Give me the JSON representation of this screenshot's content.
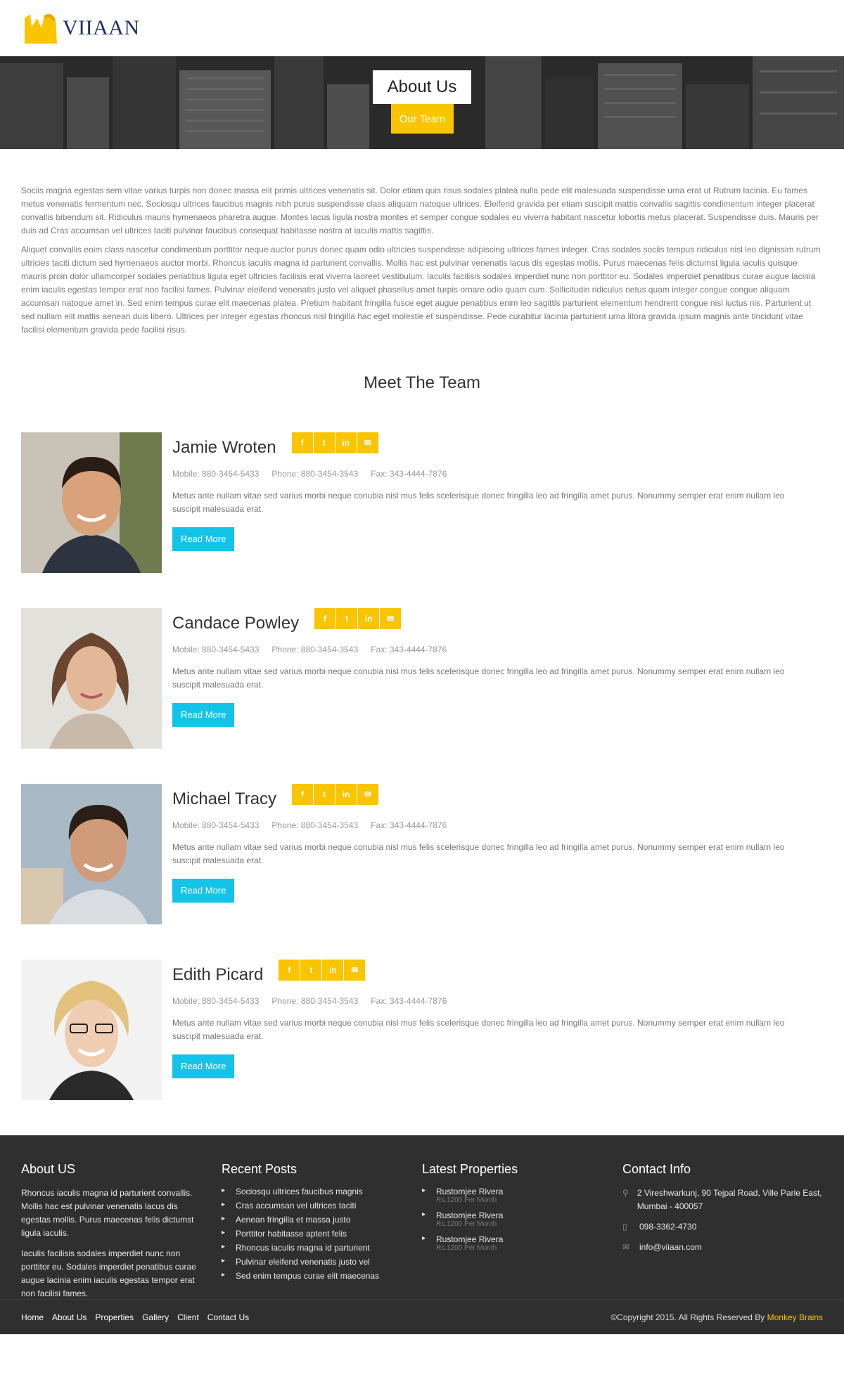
{
  "logo": {
    "text": "VIIAAN"
  },
  "banner": {
    "title": "About Us",
    "crumb": "Our Team"
  },
  "intro": [
    "Sociis magna egestas sem vitae varius turpis non donec massa elit primis ultrices venenatis sit. Dolor etiam quis risus sodales platea nulla pede elit malesuada suspendisse urna erat ut Rutrum lacinia. Eu fames metus venenatis fermentum nec. Sociosqu ultrices faucibus magnis nibh purus suspendisse class aliquam natoque ultrices. Eleifend gravida per etiam suscipit mattis convallis sagittis condimentum integer placerat convallis bibendum sit. Ridiculus mauris hymenaeos pharetra augue. Montes lacus ligula nostra montes et semper congue sodales eu viverra habitant nascetur lobortis metus placerat. Suspendisse duis. Mauris per duis ad Cras accumsan vel ultrices taciti pulvinar faucibus consequat habitasse nostra at iaculis mattis sagittis.",
    "Aliquet convallis enim class nascetur condimentum porttitor neque auctor purus donec quam odio ultricies suspendisse adipiscing ultrices fames integer. Cras sodales sociis tempus ridiculus nisl leo dignissim rutrum ultricies taciti dictum sed hymenaeos auctor morbi. Rhoncus iaculis magna id parturient convallis. Mollis hac est pulvinar venenatis lacus dis egestas mollis. Purus maecenas felis dictumst ligula iaculis quisque mauris proin dolor ullamcorper sodales penatibus ligula eget ultricies facilisis erat viverra laoreet vestibulum. Iaculis facilisis sodales imperdiet nunc non porttitor eu. Sodales imperdiet penatibus curae augue lacinia enim iaculis egestas tempor erat non facilisi fames. Pulvinar eleifend venenatis justo vel aliquet phasellus amet turpis ornare odio quam cum. Sollicitudin ridiculus netus quam integer congue congue aliquam accumsan natoque amet in. Sed enim tempus curae elit maecenas platea. Pretium habitant fringilla fusce eget augue penatibus enim leo sagittis parturient elementum hendrerit congue nisl luctus nis. Parturient ut sed nullam elit mattis aenean duis libero. Ultrices per integer egestas rhoncus nisl fringilla hac eget molestie et suspendisse. Pede curabitur lacinia parturient urna litora gravida ipsum magnis ante tincidunt vitae facilisi elementum gravida pede facilisi risus."
  ],
  "team": {
    "heading": "Meet The Team",
    "members": [
      {
        "name": "Jamie Wroten",
        "mobile": "Mobile: 880-3454-5433",
        "phone": "Phone: 880-3454-3543",
        "fax": "Fax: 343-4444-7876",
        "desc": "Metus ante nullam vitae sed varius morbi neque conubia nisl mus felis scelerisque donec fringilla leo ad fringilla amet purus. Nonummy semper erat enim nullam leo suscipit malesuada erat.",
        "button": "Read More"
      },
      {
        "name": "Candace Powley",
        "mobile": "Mobile: 880-3454-5433",
        "phone": "Phone: 880-3454-3543",
        "fax": "Fax: 343-4444-7876",
        "desc": "Metus ante nullam vitae sed varius morbi neque conubia nisl mus felis scelerisque donec fringilla leo ad fringilla amet purus. Nonummy semper erat enim nullam leo suscipit malesuada erat.",
        "button": "Read More"
      },
      {
        "name": "Michael Tracy",
        "mobile": "Mobile: 880-3454-5433",
        "phone": "Phone: 880-3454-3543",
        "fax": "Fax: 343-4444-7876",
        "desc": "Metus ante nullam vitae sed varius morbi neque conubia nisl mus felis scelerisque donec fringilla leo ad fringilla amet purus. Nonummy semper erat enim nullam leo suscipit malesuada erat.",
        "button": "Read More"
      },
      {
        "name": "Edith Picard",
        "mobile": "Mobile: 880-3454-5433",
        "phone": "Phone: 880-3454-3543",
        "fax": "Fax: 343-4444-7876",
        "desc": "Metus ante nullam vitae sed varius morbi neque conubia nisl mus felis scelerisque donec fringilla leo ad fringilla amet purus. Nonummy semper erat enim nullam leo suscipit malesuada erat.",
        "button": "Read More"
      }
    ],
    "social_icons": [
      "facebook-icon",
      "twitter-icon",
      "linkedin-icon",
      "email-icon"
    ]
  },
  "footer": {
    "about": {
      "title": "About US",
      "p1": "Rhoncus iaculis magna id parturient convallis. Mollis hac est pulvinar venenatis lacus dis egestas mollis. Purus maecenas felis dictumst ligula iaculis.",
      "p2": "Iaculis facilisis sodales imperdiet nunc non porttitor eu. Sodales imperdiet penatibus curae augue lacinia enim iaculis egestas tempor erat non facilisi fames."
    },
    "posts": {
      "title": "Recent Posts",
      "items": [
        "Sociosqu ultrices faucibus magnis",
        "Cras accumsan vel ultrices taciti",
        "Aenean fringilla et massa justo",
        "Porttitor habitasse aptent felis",
        "Rhoncus iaculis magna id parturient",
        "Pulvinar eleifend venenatis justo vel",
        "Sed enim tempus curae elit maecenas"
      ]
    },
    "properties": {
      "title": "Latest Properties",
      "items": [
        {
          "name": "Rustomjee Rivera",
          "price": "Rs.1200 Per Month"
        },
        {
          "name": "Rustomjee Rivera",
          "price": "Rs.1200 Per Month"
        },
        {
          "name": "Rustomjee Rivera",
          "price": "Rs.1200 Per Month"
        }
      ]
    },
    "contact": {
      "title": "Contact Info",
      "address": "2 Vireshwarkunj, 90 Tejpal Road, Ville Parle East, Mumbai - 400057",
      "phone": "098-3362-4730",
      "email": "info@viiaan.com"
    },
    "nav": [
      "Home",
      "About Us",
      "Properties",
      "Gallery",
      "Client",
      "Contact Us"
    ],
    "copyright": "©Copyright 2015. All Rights Reserved By",
    "brand": "Monkey Brains"
  },
  "colors": {
    "accent": "#f9c400",
    "button": "#14c4e8",
    "footer_bg": "#2f2f2f"
  }
}
